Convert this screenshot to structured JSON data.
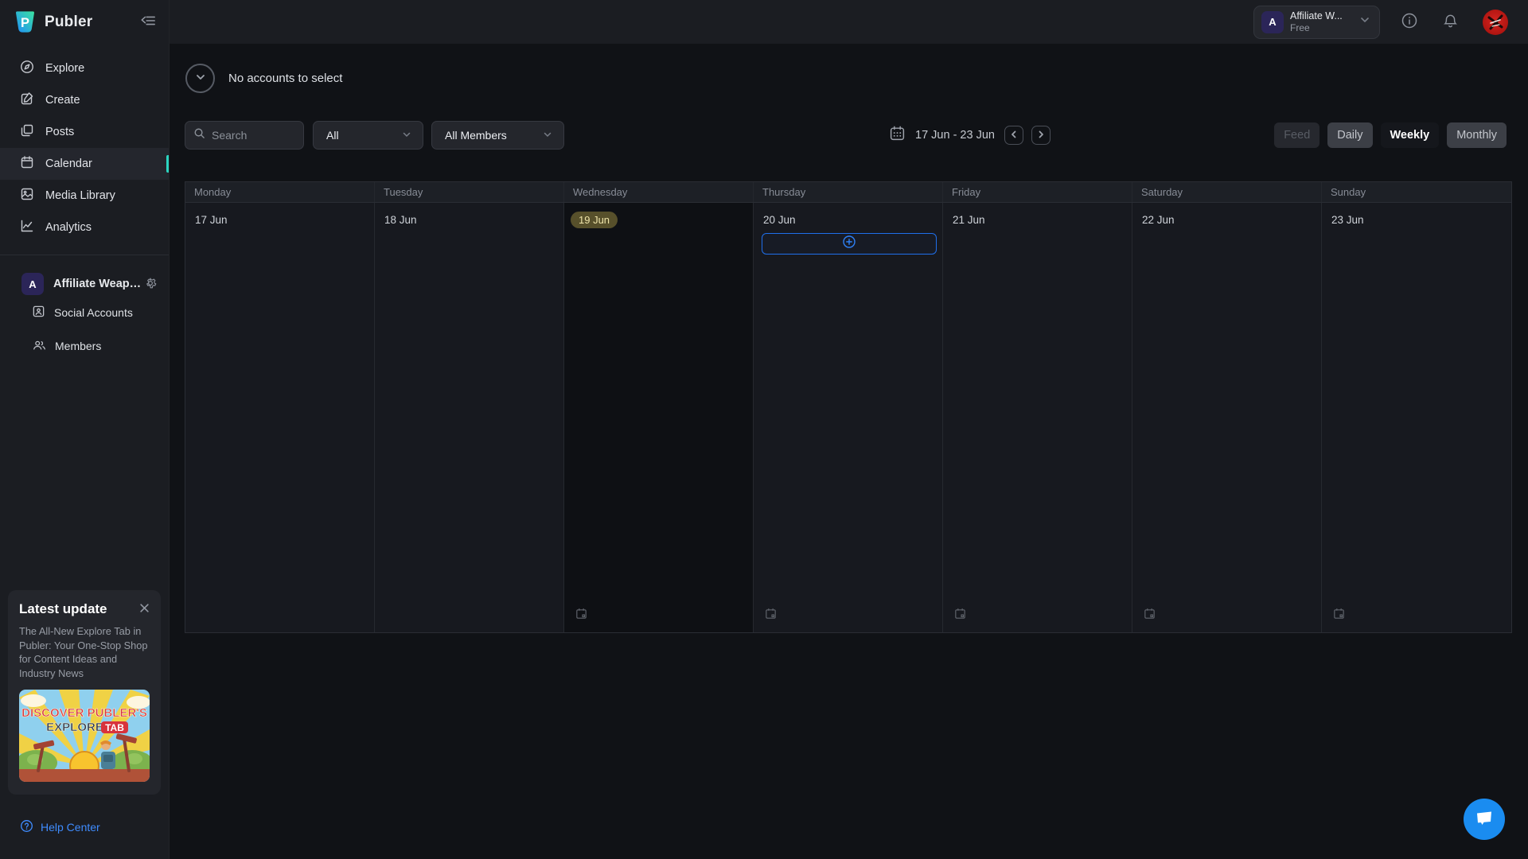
{
  "app": {
    "name": "Publer"
  },
  "colors": {
    "accent_teal": "#2bd4c0",
    "accent_blue": "#2f81f7",
    "help_link": "#3f8cff",
    "today_badge_bg": "#57502b",
    "today_badge_text": "#eee4a9",
    "chat_fab": "#1a8cf0"
  },
  "sidebar": {
    "nav": [
      {
        "label": "Explore"
      },
      {
        "label": "Create"
      },
      {
        "label": "Posts"
      },
      {
        "label": "Calendar",
        "selected": true
      },
      {
        "label": "Media Library"
      },
      {
        "label": "Analytics"
      }
    ],
    "workspace": {
      "name": "Affiliate Weap…",
      "avatar_letter": "A",
      "items": [
        {
          "label": "Social Accounts"
        },
        {
          "label": "Members"
        }
      ]
    },
    "update_card": {
      "title": "Latest update",
      "body": "The All-New Explore Tab in Publer: Your One-Stop Shop for Content Ideas and Industry News",
      "image_line1": "DISCOVER PUBLER'S",
      "image_line2": "EXPLORE",
      "image_line2b": "TAB"
    },
    "help_label": "Help Center"
  },
  "topbar": {
    "workspace_name": "Affiliate W...",
    "workspace_plan": "Free",
    "workspace_avatar_letter": "A"
  },
  "main": {
    "accounts_notice": "No accounts to select",
    "filters": {
      "search_placeholder": "Search",
      "type_filter_value": "All",
      "members_filter_value": "All Members"
    },
    "date_range": "17 Jun - 23 Jun",
    "views": [
      {
        "label": "Feed",
        "state": "disabled"
      },
      {
        "label": "Daily",
        "state": "normal"
      },
      {
        "label": "Weekly",
        "state": "selected"
      },
      {
        "label": "Monthly",
        "state": "normal"
      }
    ],
    "calendar": {
      "days": [
        {
          "weekday": "Monday",
          "date": "17 Jun",
          "today": false,
          "add_slot": false,
          "draft_icon": false
        },
        {
          "weekday": "Tuesday",
          "date": "18 Jun",
          "today": false,
          "add_slot": false,
          "draft_icon": false
        },
        {
          "weekday": "Wednesday",
          "date": "19 Jun",
          "today": true,
          "add_slot": false,
          "draft_icon": true
        },
        {
          "weekday": "Thursday",
          "date": "20 Jun",
          "today": false,
          "add_slot": true,
          "draft_icon": true
        },
        {
          "weekday": "Friday",
          "date": "21 Jun",
          "today": false,
          "add_slot": false,
          "draft_icon": true
        },
        {
          "weekday": "Saturday",
          "date": "22 Jun",
          "today": false,
          "add_slot": false,
          "draft_icon": true
        },
        {
          "weekday": "Sunday",
          "date": "23 Jun",
          "today": false,
          "add_slot": false,
          "draft_icon": true
        }
      ]
    }
  }
}
